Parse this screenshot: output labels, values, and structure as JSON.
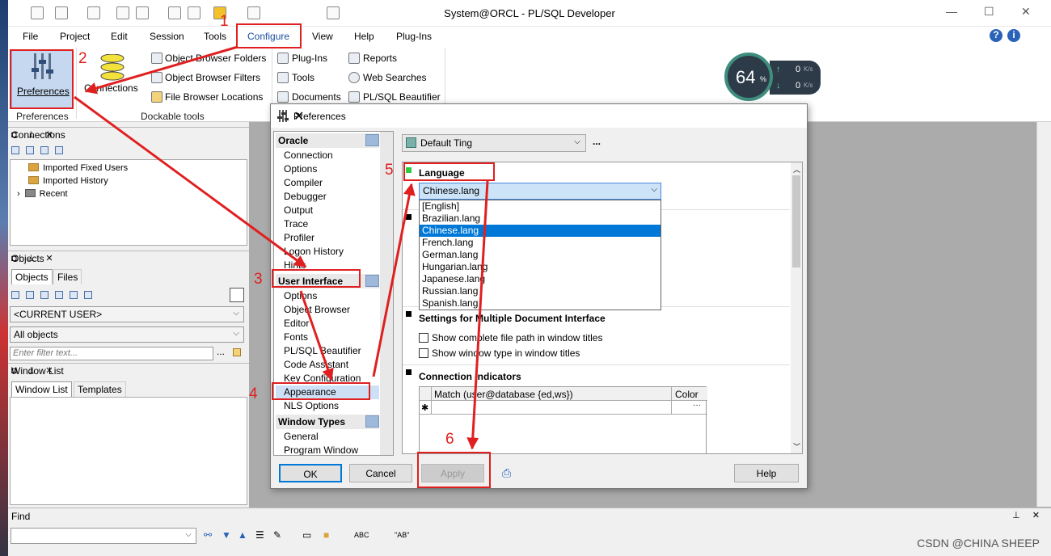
{
  "window": {
    "title": "System@ORCL - PL/SQL Developer"
  },
  "menu": [
    "File",
    "Project",
    "Edit",
    "Session",
    "Tools",
    "Configure",
    "View",
    "Help",
    "Plug-Ins"
  ],
  "ribbon": {
    "preferences_label": "Preferences",
    "connections_label": "Connections",
    "obj_folders": "Object Browser Folders",
    "obj_filters": "Object Browser Filters",
    "file_locations": "File Browser Locations",
    "plugins": "Plug-Ins",
    "tools": "Tools",
    "documents": "Documents",
    "reports": "Reports",
    "web_searches": "Web Searches",
    "beautifier": "PL/SQL Beautifier",
    "group_preferences": "Preferences",
    "group_dockable": "Dockable tools"
  },
  "monitor": {
    "percent": "64",
    "pct_sign": "%",
    "up": "0",
    "down": "0",
    "unit": "K/s"
  },
  "connections": {
    "title": "Connections",
    "items": [
      "Imported Fixed Users",
      "Imported History",
      "Recent"
    ]
  },
  "objects": {
    "title": "Objects",
    "tab1": "Objects",
    "tab2": "Files",
    "user": "<CURRENT USER>",
    "filter": "All objects",
    "placeholder": "Enter filter text..."
  },
  "windowlist": {
    "title": "Window List",
    "tab1": "Window List",
    "tab2": "Templates"
  },
  "find": {
    "title": "Find",
    "abc": "ABC",
    "ab": "\"AB\""
  },
  "dialog": {
    "title": "Preferences",
    "oracle_header": "Oracle",
    "oracle_items": [
      "Connection",
      "Options",
      "Compiler",
      "Debugger",
      "Output",
      "Trace",
      "Profiler",
      "Logon History",
      "Hints"
    ],
    "ui_header": "User Interface",
    "ui_items": [
      "Options",
      "Object Browser",
      "Editor",
      "Fonts",
      "PL/SQL Beautifier",
      "Code Assistant",
      "Key Configuration",
      "Appearance",
      "NLS Options"
    ],
    "wt_header": "Window Types",
    "wt_items": [
      "General",
      "Program Window"
    ],
    "profile": "Default Ting",
    "more": "...",
    "lang_section": "Language",
    "lang_selected": "Chinese.lang",
    "lang_options": [
      "[English]",
      "Brazilian.lang",
      "Chinese.lang",
      "French.lang",
      "German.lang",
      "Hungarian.lang",
      "Japanese.lang",
      "Russian.lang",
      "Spanish.lang"
    ],
    "mdi_section": "Settings for Multiple Document Interface",
    "mdi_opt1": "Show complete file path in window titles",
    "mdi_opt2": "Show window type in window titles",
    "conn_section": "Connection Indicators",
    "col_match": "Match (user@database {ed,ws})",
    "col_color": "Color",
    "new_row": "✱",
    "ellipsis": "···",
    "ok": "OK",
    "cancel": "Cancel",
    "apply": "Apply",
    "help": "Help"
  },
  "steps": [
    "1",
    "2",
    "3",
    "4",
    "5",
    "6"
  ],
  "watermark": "CSDN @CHINA SHEEP",
  "colors": {
    "annotation": "#e02020",
    "selection": "#0078d7"
  }
}
